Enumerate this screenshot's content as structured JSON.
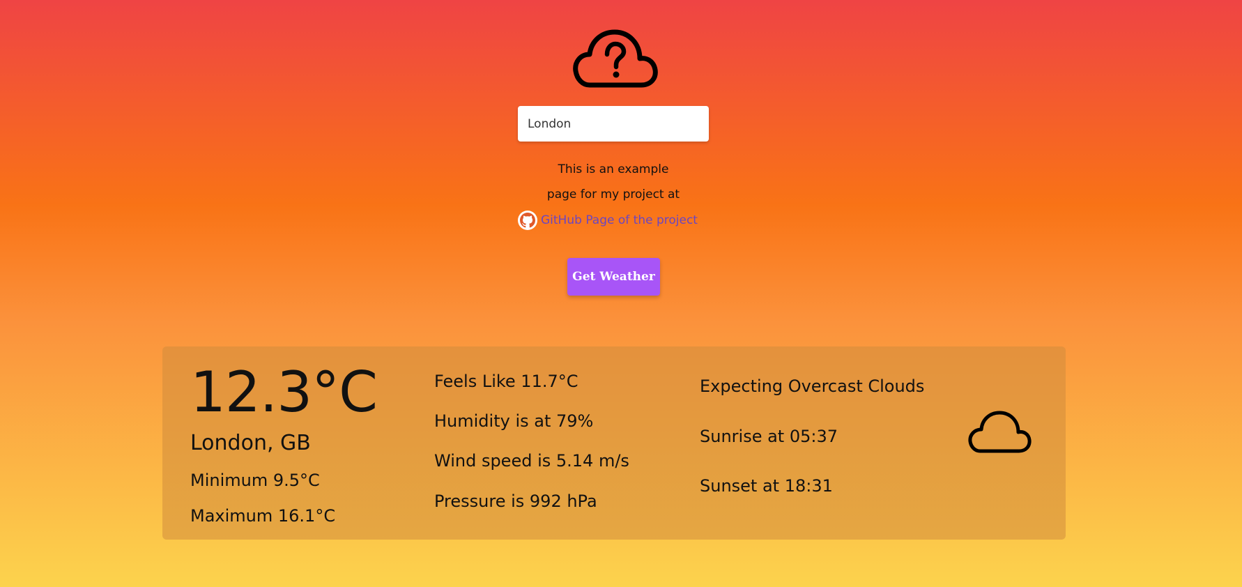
{
  "header": {
    "icon": "cloud-question-icon"
  },
  "search": {
    "value": "London",
    "placeholder": ""
  },
  "info": {
    "line1": "This is an example",
    "line2": "page for my project at",
    "github_icon": "github-icon",
    "link_label": "GitHub Page of the project"
  },
  "actions": {
    "get_weather_label": "Get Weather"
  },
  "weather": {
    "temperature": "12.3°C",
    "city": "London, GB",
    "minimum": "Minimum 9.5°C",
    "maximum": "Maximum 16.1°C",
    "feels_like": "Feels Like 11.7°C",
    "humidity": "Humidity is at 79%",
    "wind_speed": "Wind speed is 5.14 m/s",
    "pressure": "Pressure is 992 hPa",
    "description": "Expecting Overcast Clouds",
    "sunrise": "Sunrise at 05:37",
    "sunset": "Sunset at 18:31",
    "icon": "cloud-icon"
  },
  "colors": {
    "gradient_top": "#ef4444",
    "gradient_bottom": "#fcd34d",
    "button": "#a855f7",
    "link": "#6b46c1"
  }
}
